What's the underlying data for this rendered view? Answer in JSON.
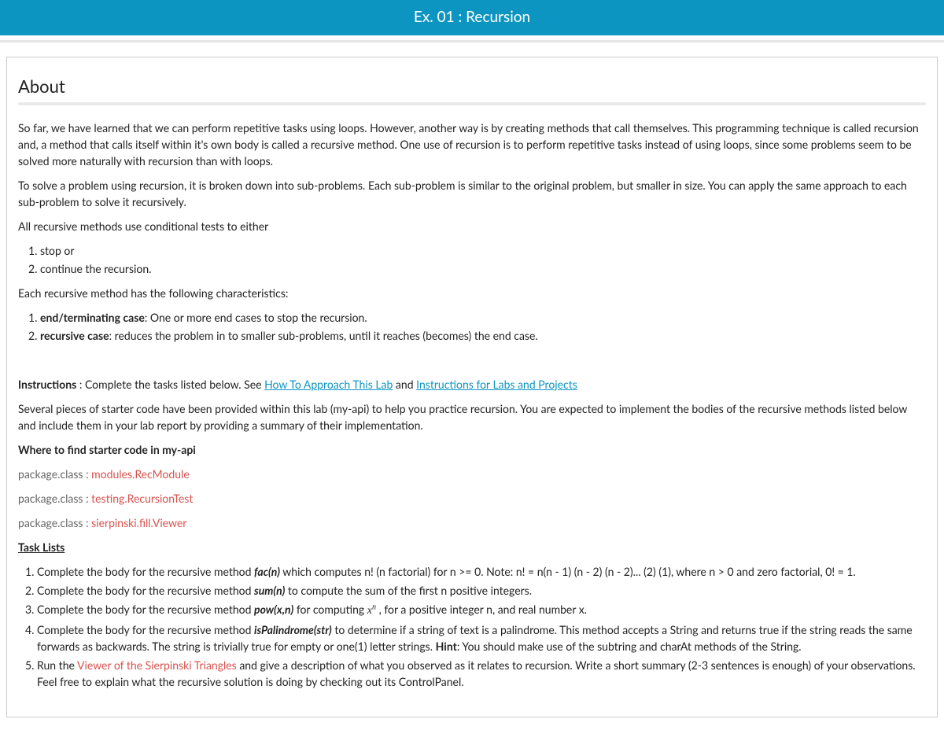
{
  "header": {
    "title": "Ex. 01 : Recursion"
  },
  "about": {
    "heading": "About",
    "p1": "So far, we have learned that we can perform repetitive tasks using loops. However, another way is by creating methods that call themselves. This programming technique is called recursion and, a method that calls itself within it's own body is called a recursive method. One use of recursion is to perform repetitive tasks instead of using loops, since some problems seem to be solved more naturally with recursion than with loops.",
    "p2": "To solve a problem using recursion, it is broken down into sub-problems. Each sub-problem is similar to the original problem, but smaller in size. You can apply the same approach to each sub-problem to solve it recursively.",
    "p3": "All recursive methods use conditional tests  to either",
    "cond_list": [
      "stop or",
      "continue the recursion."
    ],
    "p4": "Each recursive method has the following characteristics:",
    "char_list": [
      {
        "b": "end/terminating case",
        "rest": ": One or more end cases to stop the recursion."
      },
      {
        "b": "recursive case",
        "rest": ": reduces the problem in to smaller sub-problems, until it reaches (becomes) the end case."
      }
    ]
  },
  "instructions": {
    "label": "Instructions",
    "intro_prefix": " : Complete the tasks listed below. See ",
    "link1": "How To Approach This Lab",
    "intro_mid": "  and ",
    "link2": "Instructions for Labs and Projects",
    "p_starter": "Several pieces of starter code have been provided within this lab (my-api) to help you practice recursion. You are expected to implement the bodies of the recursive methods listed below and include them in your lab report by providing a summary of their implementation.",
    "where_heading": "Where to find starter code in my-api",
    "pkg_label": "package.class : ",
    "pkg1": "modules.RecModule",
    "pkg2": "testing.RecursionTest",
    "pkg3": "sierpinski.fill.Viewer",
    "task_heading": "Task Lists"
  },
  "tasks": {
    "t1_a": "Complete the body for the  recursive method ",
    "t1_b": "fac(n)",
    "t1_c": " which computes n! (n factorial) for n >= 0. Note: n! = n(n - 1) (n - 2) (n - 2)... (2) (1), where n > 0 and zero factorial, 0! = 1.",
    "t2_a": "Complete the body for the  recursive method ",
    "t2_b": "sum(n)",
    "t2_c": " to compute the sum of the first n positive integers.",
    "t3_a": "Complete the body for the  recursive method ",
    "t3_b": "pow(x,n)",
    "t3_c1": " for computing ",
    "t3_mathx": "x",
    "t3_mathn": "n",
    "t3_c2": " , for a positive integer n, and real number x.",
    "t4_a": "Complete the body for the  recursive method ",
    "t4_b": "isPalindrome(str)",
    "t4_c1": " to determine if a string of text is a palindrome.  This method accepts a String and returns true if the string reads the same forwards as backwards. The string is trivially true for empty or one(1) letter strings. ",
    "t4_hint": "Hint",
    "t4_c2": ": You should make use of the subtring and charAt methods of the String.",
    "t5_a": "Run the ",
    "t5_link": "Viewer of the Sierpinski Triangles",
    "t5_c": " and give a description of what you observed as it relates to recursion. Write a short summary (2-3 sentences is enough) of your observations. Feel free to explain what the recursive solution is doing by checking out its ControlPanel."
  }
}
